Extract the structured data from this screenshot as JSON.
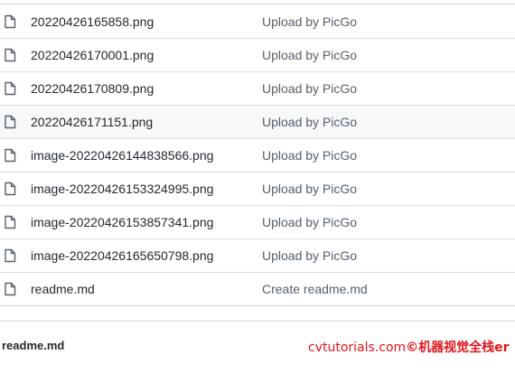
{
  "files": [
    {
      "name": "20220426165858.png",
      "message": "Upload by PicGo",
      "icon": "file-icon"
    },
    {
      "name": "20220426170001.png",
      "message": "Upload by PicGo",
      "icon": "file-icon"
    },
    {
      "name": "20220426170809.png",
      "message": "Upload by PicGo",
      "icon": "file-icon"
    },
    {
      "name": "20220426171151.png",
      "message": "Upload by PicGo",
      "icon": "file-icon"
    },
    {
      "name": "image-20220426144838566.png",
      "message": "Upload by PicGo",
      "icon": "file-icon"
    },
    {
      "name": "image-20220426153324995.png",
      "message": "Upload by PicGo",
      "icon": "file-icon"
    },
    {
      "name": "image-20220426153857341.png",
      "message": "Upload by PicGo",
      "icon": "file-icon"
    },
    {
      "name": "image-20220426165650798.png",
      "message": "Upload by PicGo",
      "icon": "file-icon"
    },
    {
      "name": "readme.md",
      "message": "Create readme.md",
      "icon": "file-icon"
    }
  ],
  "readme": {
    "title": "readme.md"
  },
  "watermark": {
    "site": "cvtutorials.com",
    "copyright": "©机器视觉全栈er"
  },
  "colors": {
    "accent": "#e1161c",
    "hover_row": "#f6f8fa",
    "text": "#24292f",
    "muted": "#57606a"
  }
}
